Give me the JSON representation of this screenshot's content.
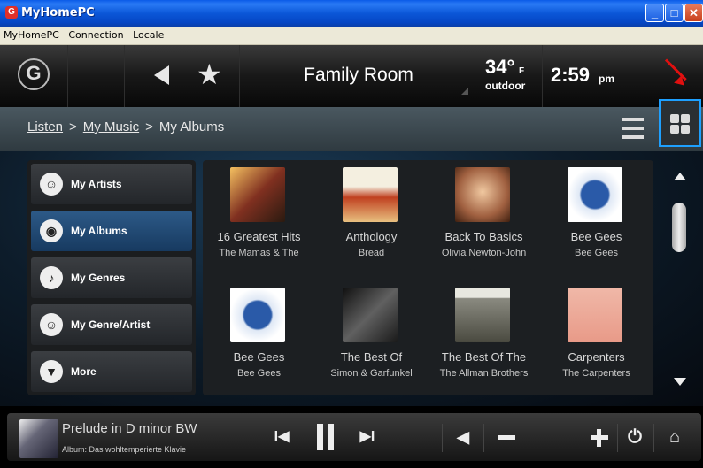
{
  "window": {
    "title": "MyHomePC",
    "menu": [
      "MyHomePC",
      "Connection",
      "Locale"
    ]
  },
  "topbar": {
    "room": "Family Room",
    "temperature": "34°",
    "temperature_unit": "F",
    "temperature_label": "outdoor",
    "time": "2:59",
    "ampm": "pm"
  },
  "breadcrumb": {
    "items": [
      "Listen",
      "My Music",
      "My Albums"
    ],
    "separator": ">"
  },
  "sidebar": {
    "items": [
      {
        "label": "My Artists",
        "icon": "artists-icon"
      },
      {
        "label": "My Albums",
        "icon": "album-disc-icon",
        "active": true
      },
      {
        "label": "My Genres",
        "icon": "genres-icon"
      },
      {
        "label": "My Genre/Artist",
        "icon": "genre-artist-icon"
      },
      {
        "label": "More",
        "icon": "more-chevron-icon"
      }
    ]
  },
  "albums": [
    {
      "title": "16 Greatest Hits",
      "artist": "The Mamas & The"
    },
    {
      "title": "Anthology",
      "artist": "Bread"
    },
    {
      "title": "Back To Basics",
      "artist": "Olivia Newton-John"
    },
    {
      "title": "Bee Gees",
      "artist": "Bee Gees"
    },
    {
      "title": "Bee Gees",
      "artist": "Bee Gees"
    },
    {
      "title": "The Best Of",
      "artist": "Simon & Garfunkel"
    },
    {
      "title": "The Best Of The",
      "artist": "The Allman Brothers"
    },
    {
      "title": "Carpenters",
      "artist": "The Carpenters"
    }
  ],
  "now_playing": {
    "title": "Prelude in D minor BW",
    "album": "Album: Das wohltemperierte Klavie"
  },
  "colors": {
    "accent": "#1ea0ff",
    "active_item": "#2d5a88",
    "annotation_arrow": "#e01010"
  }
}
